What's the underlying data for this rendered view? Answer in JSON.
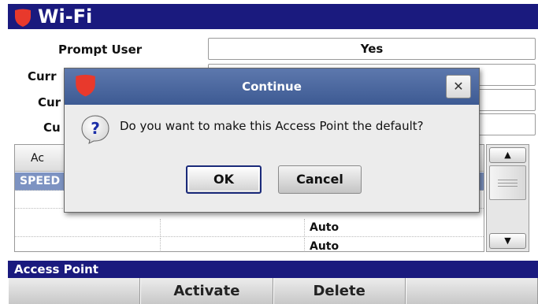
{
  "colors": {
    "title_bar": "#1a1a7e",
    "accent_red": "#e8392c",
    "selected_row": "#7d93c2",
    "dialog_title": "#4a66a0"
  },
  "header": {
    "title": "Wi-Fi",
    "icon": "shield-icon"
  },
  "settings": {
    "prompt_user_label": "Prompt User",
    "prompt_user_value": "Yes",
    "row2_label": "Curr",
    "row3_label": "Cur",
    "row4_label": "Cu"
  },
  "table": {
    "header_col1": "Ac",
    "rows": [
      {
        "col1": "SPEED",
        "col3": ""
      },
      {
        "col1": "",
        "col3": ""
      },
      {
        "col1": "",
        "col3": "Auto"
      },
      {
        "col1": "",
        "col3": "Auto"
      }
    ]
  },
  "scrollbar": {
    "up_icon": "triangle-up-icon",
    "down_icon": "triangle-down-icon"
  },
  "footer": {
    "section_label": "Access Point",
    "softkeys": [
      "",
      "Activate",
      "Delete",
      ""
    ]
  },
  "dialog": {
    "title": "Continue",
    "close_icon": "close-icon",
    "message_icon": "question-icon",
    "message": "Do you want to make this Access Point the default?",
    "ok_label": "OK",
    "cancel_label": "Cancel"
  }
}
